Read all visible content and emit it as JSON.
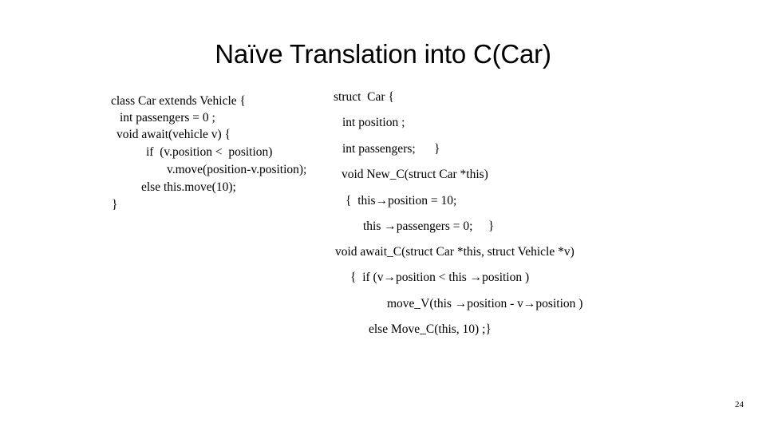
{
  "slide": {
    "title": "Naïve Translation into C(Car)",
    "page_number": "24",
    "background_color": "#ffffff",
    "text_color": "#000000"
  },
  "java_block": {
    "name": "java-source-code",
    "language": "Java",
    "lines": [
      "class Car extends Vehicle {",
      "int passengers = 0 ;",
      "void await(vehicle v) {",
      "if  (v.position <  position)",
      "v.move(position-v.position);",
      "else this.move(10);",
      "}"
    ]
  },
  "c_block": {
    "name": "c-translation-code",
    "language": "C",
    "lines": [
      "struct  Car {",
      "int position ;",
      "int passengers;      }",
      "void New_C(struct Car *this)",
      "{  this→position = 10;",
      "this →passengers = 0;     }",
      "void await_C(struct Car *this, struct Vehicle *v)",
      "{  if (v→position < this →position )",
      "move_V(this →position - v→position )",
      "else Move_C(this, 10) ;}"
    ]
  }
}
